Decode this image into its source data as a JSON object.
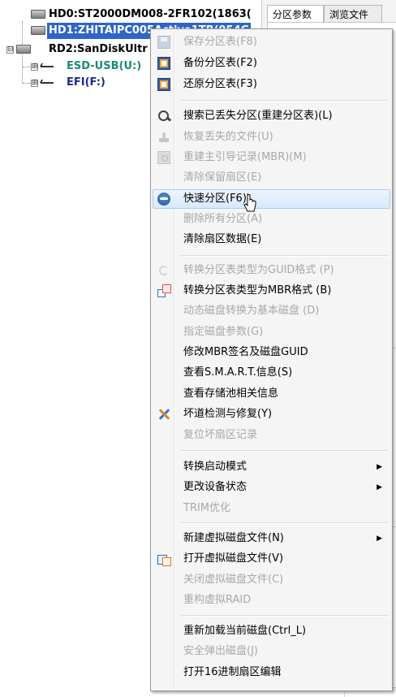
{
  "tree": {
    "disks": [
      {
        "label": "HD0:ST2000DM008-2FR102(1863("
      },
      {
        "label": "HD1:ZHITAIPC005Active1TB(954G"
      },
      {
        "label": "RD2:SanDiskUltr"
      }
    ],
    "partitions": [
      {
        "label": "ESD-USB(U:)",
        "color": "#1a8c74"
      },
      {
        "label": "EFI(F:)",
        "color": "#1a2b8c"
      }
    ],
    "expander_symbol": "⊞",
    "collapse_symbol": "⊟"
  },
  "right_panel": {
    "tabs": [
      "分区参数",
      "浏览文件"
    ]
  },
  "menu": {
    "items": [
      {
        "label": "保存分区表(F8)",
        "disabled": true,
        "icon": "save-icon"
      },
      {
        "label": "备份分区表(F2)",
        "disabled": false,
        "icon": "backup-table-icon"
      },
      {
        "label": "还原分区表(F3)",
        "disabled": false,
        "icon": "restore-table-icon"
      },
      {
        "label": "搜索已丢失分区(重建分区表)(L)",
        "disabled": false,
        "icon": "search-icon"
      },
      {
        "label": "恢复丢失的文件(U)",
        "disabled": true,
        "icon": "recover-files-icon"
      },
      {
        "label": "重建主引导记录(MBR)(M)",
        "disabled": true,
        "icon": "mbr-icon"
      },
      {
        "label": "清除保留扇区(E)",
        "disabled": true,
        "icon": ""
      },
      {
        "label": "快速分区(F6)",
        "disabled": false,
        "icon": "quick-partition-icon",
        "hover": true
      },
      {
        "label": "删除所有分区(A)",
        "disabled": true,
        "icon": ""
      },
      {
        "label": "清除扇区数据(E)",
        "disabled": false,
        "icon": ""
      },
      {
        "label": "转换分区表类型为GUID格式 (P)",
        "disabled": true,
        "icon": "convert-guid-icon"
      },
      {
        "label": "转换分区表类型为MBR格式 (B)",
        "disabled": false,
        "icon": "convert-mbr-icon"
      },
      {
        "label": "动态磁盘转换为基本磁盘 (D)",
        "disabled": true,
        "icon": ""
      },
      {
        "label": "指定磁盘参数(G)",
        "disabled": true,
        "icon": ""
      },
      {
        "label": "修改MBR签名及磁盘GUID",
        "disabled": false,
        "icon": ""
      },
      {
        "label": "查看S.M.A.R.T.信息(S)",
        "disabled": false,
        "icon": ""
      },
      {
        "label": "查看存储池相关信息",
        "disabled": false,
        "icon": ""
      },
      {
        "label": "坏道检测与修复(Y)",
        "disabled": false,
        "icon": "repair-tools-icon"
      },
      {
        "label": "复位坏扇区记录",
        "disabled": true,
        "icon": ""
      },
      {
        "label": "转换启动模式",
        "disabled": false,
        "icon": "",
        "submenu": true
      },
      {
        "label": "更改设备状态",
        "disabled": false,
        "icon": "",
        "submenu": true
      },
      {
        "label": "TRIM优化",
        "disabled": true,
        "icon": ""
      },
      {
        "label": "新建虚拟磁盘文件(N)",
        "disabled": false,
        "icon": "",
        "submenu": true
      },
      {
        "label": "打开虚拟磁盘文件(V)",
        "disabled": false,
        "icon": "virtual-disk-icon"
      },
      {
        "label": "关闭虚拟磁盘文件(C)",
        "disabled": true,
        "icon": ""
      },
      {
        "label": "重构虚拟RAID",
        "disabled": true,
        "icon": ""
      },
      {
        "label": "重新加载当前磁盘(Ctrl_L)",
        "disabled": false,
        "icon": ""
      },
      {
        "label": "安全弹出磁盘(J)",
        "disabled": true,
        "icon": ""
      },
      {
        "label": "打开16进制扇区编辑",
        "disabled": false,
        "icon": ""
      }
    ],
    "submenu_arrow": "▶",
    "colors": {
      "disabled_text": "#a8a8a8",
      "hover_bg": "#d7e8fb",
      "hover_border": "#a8cdf1",
      "selection": "#2f66c6"
    }
  }
}
